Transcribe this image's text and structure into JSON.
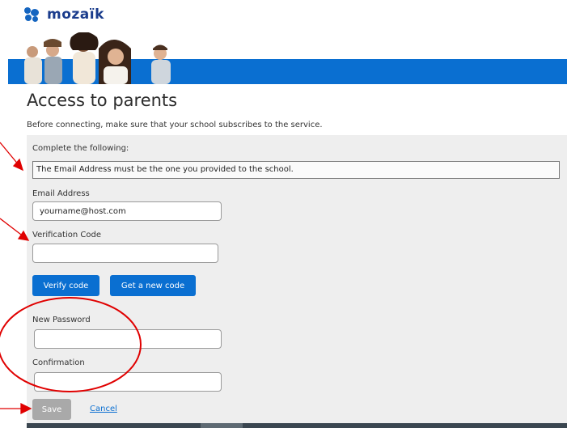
{
  "brand": {
    "name": "mozaïk",
    "color": "#1a3c8c"
  },
  "banner": {
    "bar_color": "#0a6fd1"
  },
  "page": {
    "title": "Access to parents",
    "intro": "Before connecting, make sure that your school subscribes to the service."
  },
  "form": {
    "heading": "Complete the following:",
    "notice": "The Email Address must be the one you provided to the school.",
    "email": {
      "label": "Email Address",
      "value": "yourname@host.com"
    },
    "verification": {
      "label": "Verification Code",
      "value": ""
    },
    "verify_button": "Verify code",
    "new_code_button": "Get a new code",
    "new_password": {
      "label": "New Password",
      "value": ""
    },
    "confirmation": {
      "label": "Confirmation",
      "value": ""
    },
    "save_button": "Save",
    "cancel_link": "Cancel"
  },
  "annotations": {
    "color": "#e00000"
  }
}
